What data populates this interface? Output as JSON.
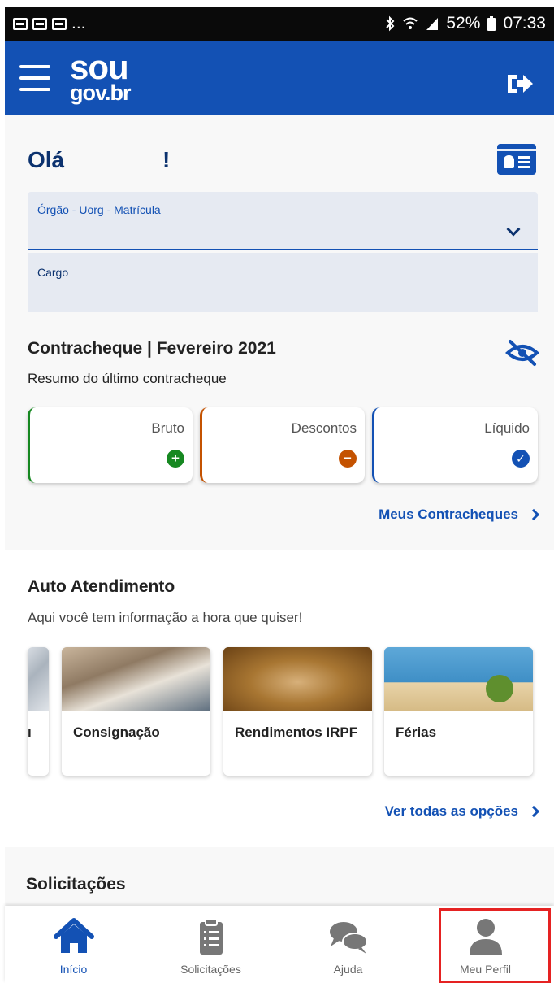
{
  "status_bar": {
    "left_text": "...",
    "battery": "52%",
    "time": "07:33"
  },
  "header": {
    "logo_top": "sou",
    "logo_bottom": "gov.br"
  },
  "greeting": {
    "hello": "Olá",
    "exclamation": "!"
  },
  "fields": {
    "orgao_label": "Órgão - Uorg - Matrícula",
    "cargo_label": "Cargo"
  },
  "payslip": {
    "title": "Contracheque | Fevereiro 2021",
    "subtitle": "Resumo do último contracheque",
    "cards": [
      {
        "label": "Bruto",
        "icon": "plus-circle-icon"
      },
      {
        "label": "Descontos",
        "icon": "minus-circle-icon"
      },
      {
        "label": "Líquido",
        "icon": "check-circle-icon"
      }
    ],
    "link": "Meus Contracheques"
  },
  "auto_atendimento": {
    "title": "Auto Atendimento",
    "subtitle": "Aqui você tem informação a hora que quiser!",
    "services": [
      {
        "label": "ı"
      },
      {
        "label": "Consignação"
      },
      {
        "label": "Rendimentos IRPF"
      },
      {
        "label": "Férias"
      }
    ],
    "link": "Ver todas as opções"
  },
  "solicitacoes": {
    "title": "Solicitações"
  },
  "bottom_nav": [
    {
      "label": "Início",
      "icon": "home-icon"
    },
    {
      "label": "Solicitações",
      "icon": "clipboard-icon"
    },
    {
      "label": "Ajuda",
      "icon": "chat-bubbles-icon"
    },
    {
      "label": "Meu Perfil",
      "icon": "user-icon"
    }
  ],
  "colors": {
    "primary": "#1351b4",
    "dark_blue": "#0c326f",
    "green": "#168821",
    "orange": "#c45200",
    "highlight": "#e52222"
  }
}
